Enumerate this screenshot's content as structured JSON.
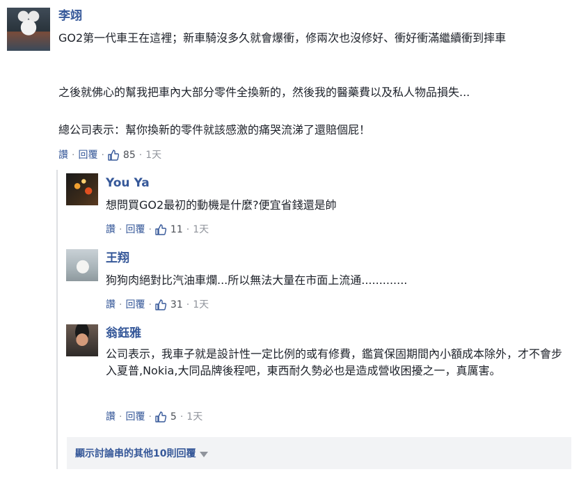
{
  "main_comment": {
    "author": "李翊",
    "paragraphs": [
      "GO2第一代車王在這裡；新車騎沒多久就會爆衝，修兩次也沒修好、衝好衝滿繼續衝到摔車",
      "之後就佛心的幫我把車內大部分零件全換新的，然後我的醫藥費以及私人物品損失...",
      "總公司表示：幫你換新的零件就該感激的痛哭流涕了還賠個屁！"
    ],
    "like_label": "讚",
    "reply_label": "回覆",
    "likes": "85",
    "time": "1天"
  },
  "replies": [
    {
      "author": "You Ya",
      "text": "想問買GO2最初的動機是什麼?便宜省錢還是帥",
      "like_label": "讚",
      "reply_label": "回覆",
      "likes": "11",
      "time": "1天"
    },
    {
      "author": "王翔",
      "text": "狗狗肉絕對比汽油車爛...所以無法大量在市面上流通.............",
      "like_label": "讚",
      "reply_label": "回覆",
      "likes": "31",
      "time": "1天"
    },
    {
      "author": "翁鈺雅",
      "text": "公司表示，我車子就是設計性一定比例的或有修費，鑑賞保固期間內小額成本除外，才不會步入夏普,Nokia,大同品牌後程吧，東西耐久勢必也是造成營收困擾之一，真厲害。",
      "like_label": "讚",
      "reply_label": "回覆",
      "likes": "5",
      "time": "1天"
    }
  ],
  "more_replies_label": "顯示討論串的其他10則回覆",
  "icons": {
    "like": "thumbs-up-icon",
    "more": "caret-down-icon"
  },
  "colors": {
    "link": "#365899",
    "text": "#1d2129",
    "meta": "#90949c",
    "bar": "#f2f3f5"
  }
}
